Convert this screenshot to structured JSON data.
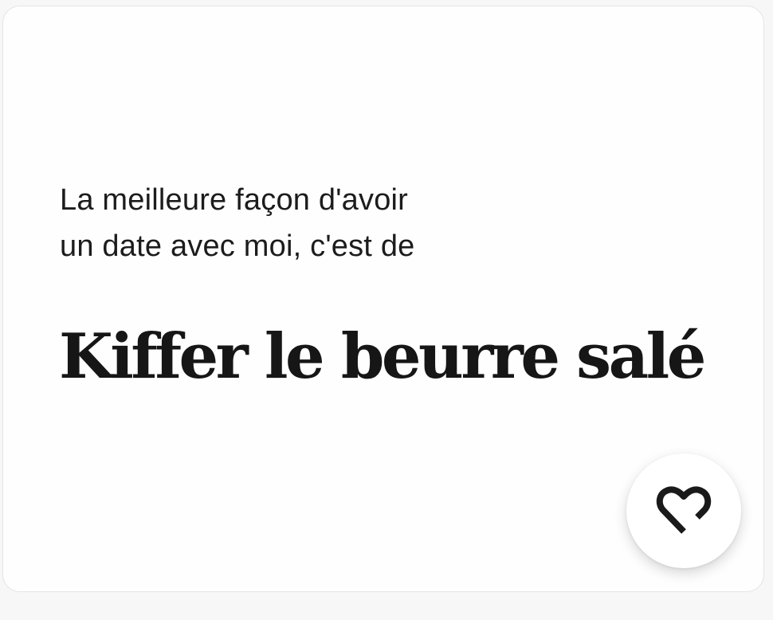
{
  "prompt": {
    "line1": "La meilleure façon d'avoir",
    "line2": "un date avec moi, c'est de"
  },
  "answer": {
    "text": "Kiffer le beurre salé"
  },
  "like_button": {
    "icon": "heart-icon",
    "icon_color": "#1a1a1a"
  },
  "colors": {
    "card_background": "#fefefe",
    "page_background": "#f7f7f7",
    "text": "#1c1c1c"
  }
}
